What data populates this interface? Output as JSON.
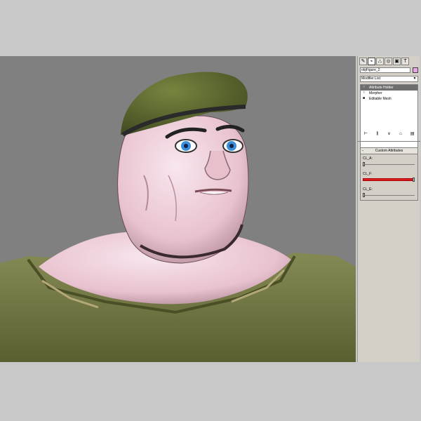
{
  "command_panel": {
    "tabs": [
      {
        "name": "create-icon",
        "glyph": "✎"
      },
      {
        "name": "modify-icon",
        "glyph": "⌁"
      },
      {
        "name": "hierarchy-icon",
        "glyph": "⛬"
      },
      {
        "name": "motion-icon",
        "glyph": "◎"
      },
      {
        "name": "display-icon",
        "glyph": "▣"
      },
      {
        "name": "utilities-icon",
        "glyph": "T"
      }
    ],
    "object_name": "objFigure_2",
    "object_color": "#e6a6e6",
    "modifier_list_label": "Modifier List",
    "stack": [
      {
        "label": "Attribute Holder",
        "icon": "○",
        "selected": true
      },
      {
        "label": "Morpher",
        "icon": "♀",
        "selected": false
      },
      {
        "label": "Editable Mesh",
        "icon": "■",
        "selected": false
      }
    ],
    "stack_toolbar": [
      "⊢",
      "⫼",
      "∨",
      "⌂",
      "▤"
    ],
    "custom_attributes": {
      "title": "Custom Attributes",
      "collapse_symbol": "-",
      "attributes": [
        {
          "label": "CL_A:",
          "value": 0.0
        },
        {
          "label": "CL_F:",
          "value": 1.0
        },
        {
          "label": "CL_E:",
          "value": 0.0
        }
      ]
    }
  },
  "colors": {
    "viewport_bg": "#808080",
    "skin": "#f2d2dc",
    "beret": "#5c6a34",
    "shirt": "#6e7340",
    "eye": "#3a8ed8",
    "slider_fill": "#e01a24"
  }
}
